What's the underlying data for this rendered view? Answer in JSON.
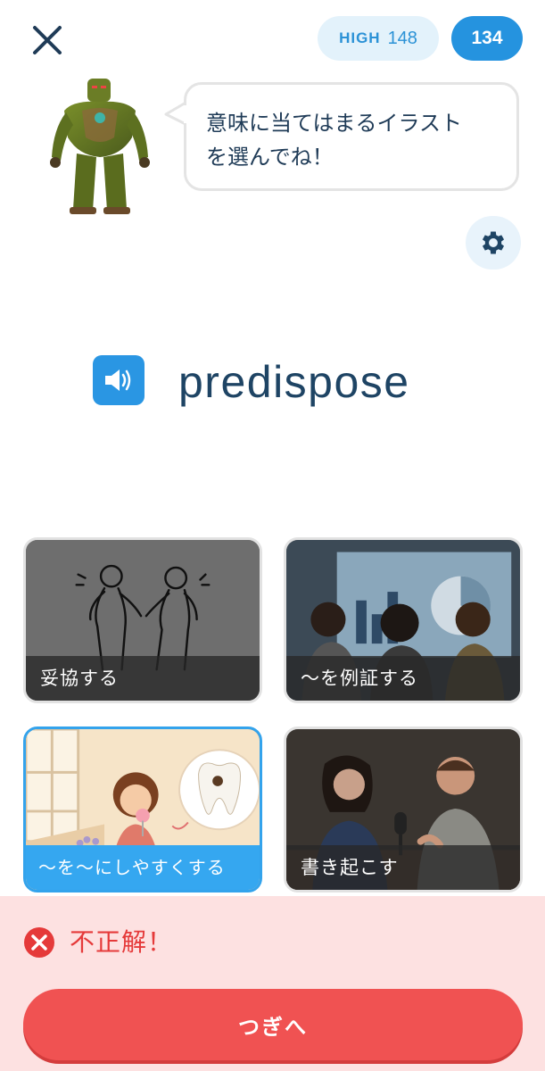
{
  "header": {
    "close_icon": "close-icon",
    "high_label": "HIGH",
    "high_value": "148",
    "score": "134"
  },
  "speech": {
    "text": "意味に当てはまるイラスト\nを選んでね！"
  },
  "settings_icon": "gear-icon",
  "word": {
    "speaker_icon": "speaker-icon",
    "text": "predispose"
  },
  "choices": [
    {
      "label": "妥協する",
      "selected": false
    },
    {
      "label": "～を例証する",
      "selected": false
    },
    {
      "label": "～を～にしやすくする",
      "selected": true
    },
    {
      "label": "書き起こす",
      "selected": false
    }
  ],
  "result": {
    "icon": "x-circle-icon",
    "text": "不正解！",
    "next_label": "つぎへ"
  },
  "colors": {
    "accent": "#2593df",
    "wrong": "#e53a3a",
    "wrong_bg": "#fde1e1",
    "next_button": "#f05252"
  }
}
